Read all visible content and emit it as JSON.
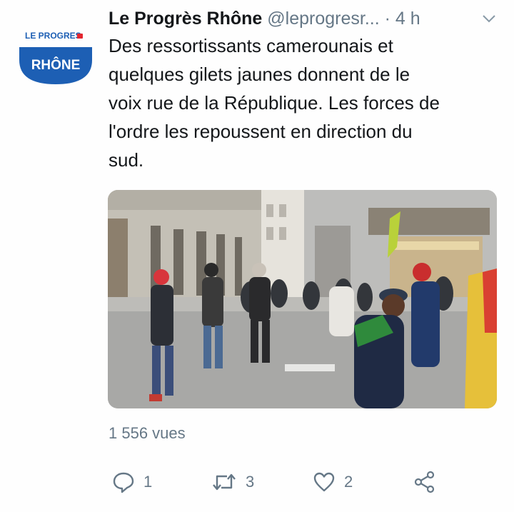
{
  "account": {
    "avatar_brand_top": "LE PROGRES",
    "avatar_brand_bottom": "RHÔNE",
    "display_name": "Le Progrès Rhône",
    "handle": "@leprogresr...",
    "separator": "·",
    "time": "4 h"
  },
  "tweet": {
    "lines": [
      "Des ressortissants camerounais et",
      "quelques gilets jaunes donnent de le",
      "voix rue de la République. Les forces de",
      "l'ordre les repoussent en direction du",
      "sud."
    ],
    "views": "1 556 vues"
  },
  "actions": {
    "reply_count": "1",
    "retweet_count": "3",
    "like_count": "2"
  },
  "icons": {
    "reply": "reply-icon",
    "retweet": "retweet-icon",
    "like": "heart-icon",
    "share": "share-icon",
    "menu": "chevron-down-icon"
  },
  "colors": {
    "brand_blue": "#1d5fb4",
    "brand_red": "#e3262f",
    "muted": "#657786",
    "text": "#14171a"
  }
}
